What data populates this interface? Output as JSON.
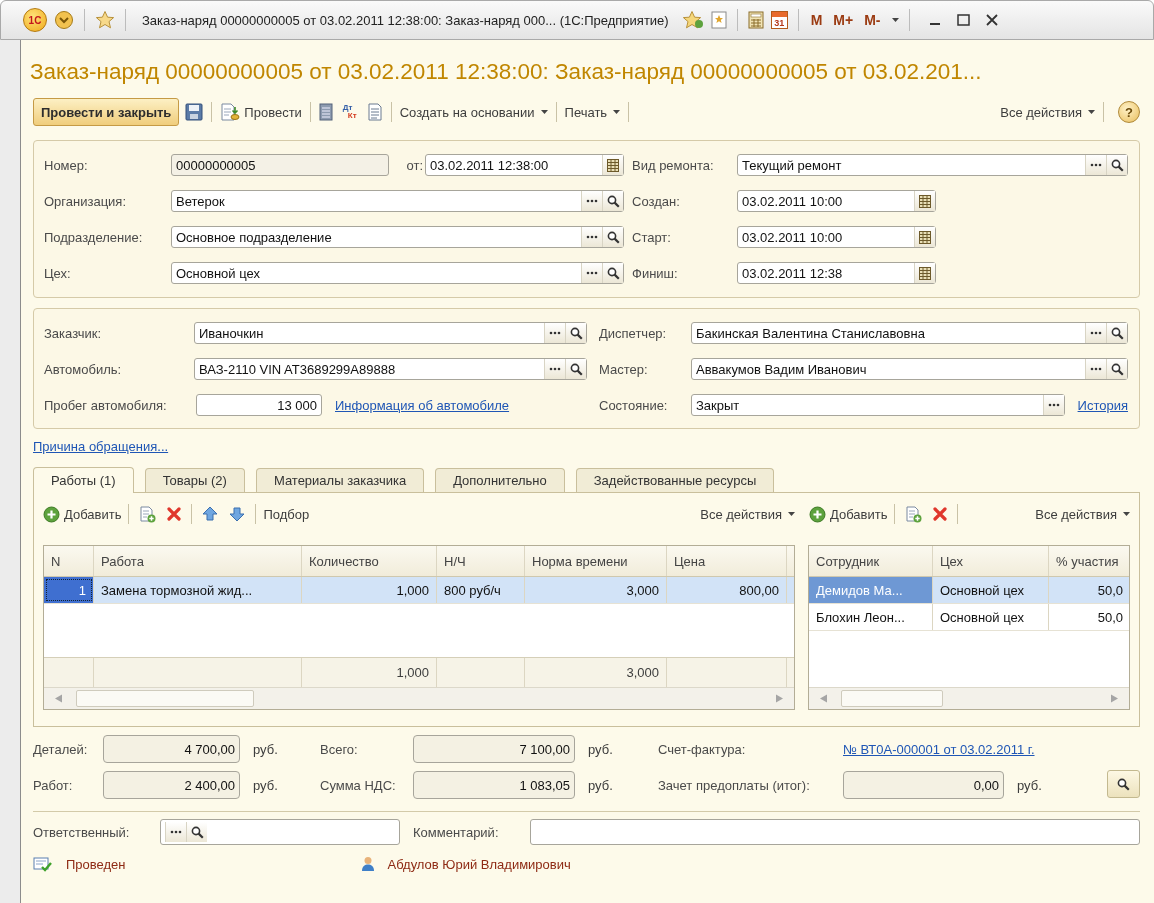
{
  "window": {
    "logo": "1С",
    "title": "Заказ-наряд 00000000005 от 03.02.2011 12:38:00: Заказ-наряд 000... (1С:Предприятие)",
    "calendar_day": "31",
    "memory_buttons": [
      "M",
      "M+",
      "M-"
    ]
  },
  "form_title": "Заказ-наряд 00000000005 от 03.02.2011 12:38:00: Заказ-наряд 00000000005 от 03.02.201...",
  "command_bar": {
    "post_and_close": "Провести и закрыть",
    "post": "Провести",
    "dt_kt": [
      "Дт",
      "Кт"
    ],
    "menus": [
      "Создать на основании",
      "Печать"
    ],
    "all_actions": "Все действия",
    "help": "?"
  },
  "header": {
    "left": [
      {
        "label": "Номер:",
        "value": "00000000005",
        "kind": "readonly",
        "date": {
          "label": "от:",
          "value": "03.02.2011 12:38:00"
        }
      },
      {
        "label": "Организация:",
        "value": "Ветерок",
        "kind": "ref"
      },
      {
        "label": "Подразделение:",
        "value": "Основное подразделение",
        "kind": "ref"
      },
      {
        "label": "Цех:",
        "value": "Основной цех",
        "kind": "ref"
      }
    ],
    "right": [
      {
        "label": "Вид ремонта:",
        "value": "Текущий ремонт",
        "kind": "ref"
      },
      {
        "label": "Создан:",
        "value": "03.02.2011 10:00",
        "kind": "date"
      },
      {
        "label": "Старт:",
        "value": "03.02.2011 10:00",
        "kind": "date"
      },
      {
        "label": "Финиш:",
        "value": "03.02.2011 12:38",
        "kind": "date"
      }
    ]
  },
  "customer": {
    "left": [
      {
        "label": "Заказчик:",
        "value": "Иваночкин",
        "kind": "ref"
      },
      {
        "label": "Автомобиль:",
        "value": "ВАЗ-2110 VIN AT3689299A89888",
        "kind": "ref"
      },
      {
        "label": "Пробег автомобиля:",
        "value": "13 000",
        "kind": "number",
        "link": "Информация об автомобиле"
      }
    ],
    "right": [
      {
        "label": "Диспетчер:",
        "value": "Бакинская Валентина Станиславовна",
        "kind": "ref"
      },
      {
        "label": "Мастер:",
        "value": "Аввакумов Вадим Иванович",
        "kind": "ref"
      },
      {
        "label": "Состояние:",
        "value": "Закрыт",
        "kind": "choice",
        "link": "История"
      }
    ]
  },
  "reason_link": "Причина обращения...",
  "tabs": [
    {
      "label": "Работы (1)",
      "selected": true
    },
    {
      "label": "Товары (2)",
      "selected": false
    },
    {
      "label": "Материалы заказчика",
      "selected": false
    },
    {
      "label": "Дополнительно",
      "selected": false
    },
    {
      "label": "Задействованные ресурсы",
      "selected": false
    }
  ],
  "works": {
    "toolbar": {
      "add": "Добавить",
      "pick": "Подбор",
      "all_actions": "Все действия"
    },
    "columns": [
      {
        "title": "N",
        "numeric": true
      },
      {
        "title": "Работа",
        "numeric": false
      },
      {
        "title": "Количество",
        "numeric": true,
        "total": "1,000"
      },
      {
        "title": "Н/Ч",
        "numeric": false
      },
      {
        "title": "Норма времени",
        "numeric": true,
        "total": "3,000"
      },
      {
        "title": "Цена",
        "numeric": true
      }
    ],
    "rows": [
      {
        "cells": [
          "1",
          "Замена тормозной жид...",
          "1,000",
          "800 руб/ч",
          "3,000",
          "800,00"
        ],
        "selected": true
      }
    ]
  },
  "staff": {
    "toolbar": {
      "add": "Добавить",
      "all_actions": "Все действия"
    },
    "columns": [
      {
        "title": "Сотрудник",
        "numeric": false
      },
      {
        "title": "Цех",
        "numeric": false
      },
      {
        "title": "% участия",
        "numeric": true
      }
    ],
    "rows": [
      {
        "cells": [
          "Демидов Ма...",
          "Основной цех",
          "50,0"
        ],
        "selected": true
      },
      {
        "cells": [
          "Блохин Леон...",
          "Основной цех",
          "50,0"
        ],
        "selected": false
      }
    ]
  },
  "totals": [
    [
      {
        "label": "Деталей:",
        "value": "4 700,00",
        "unit": "руб.",
        "kind": "amount"
      },
      {
        "label": "Всего:",
        "value": "7 100,00",
        "unit": "руб.",
        "kind": "amount"
      },
      {
        "label": "Счет-фактура:",
        "value": "№ ВТ0А-000001 от 03.02.2011 г.",
        "kind": "link"
      }
    ],
    [
      {
        "label": "Работ:",
        "value": "2 400,00",
        "unit": "руб.",
        "kind": "amount"
      },
      {
        "label": "Сумма НДС:",
        "value": "1 083,05",
        "unit": "руб.",
        "kind": "amount"
      },
      {
        "label": "Зачет предоплаты (итог):",
        "value": "0,00",
        "unit": "руб.",
        "kind": "amount"
      }
    ]
  ],
  "footer": {
    "responsible": {
      "label": "Ответственный:",
      "kind": "ref"
    },
    "comment": {
      "label": "Комментарий:",
      "kind": "text"
    }
  },
  "status": {
    "state": "Проведен",
    "author": "Абдулов Юрий Владимирович"
  }
}
